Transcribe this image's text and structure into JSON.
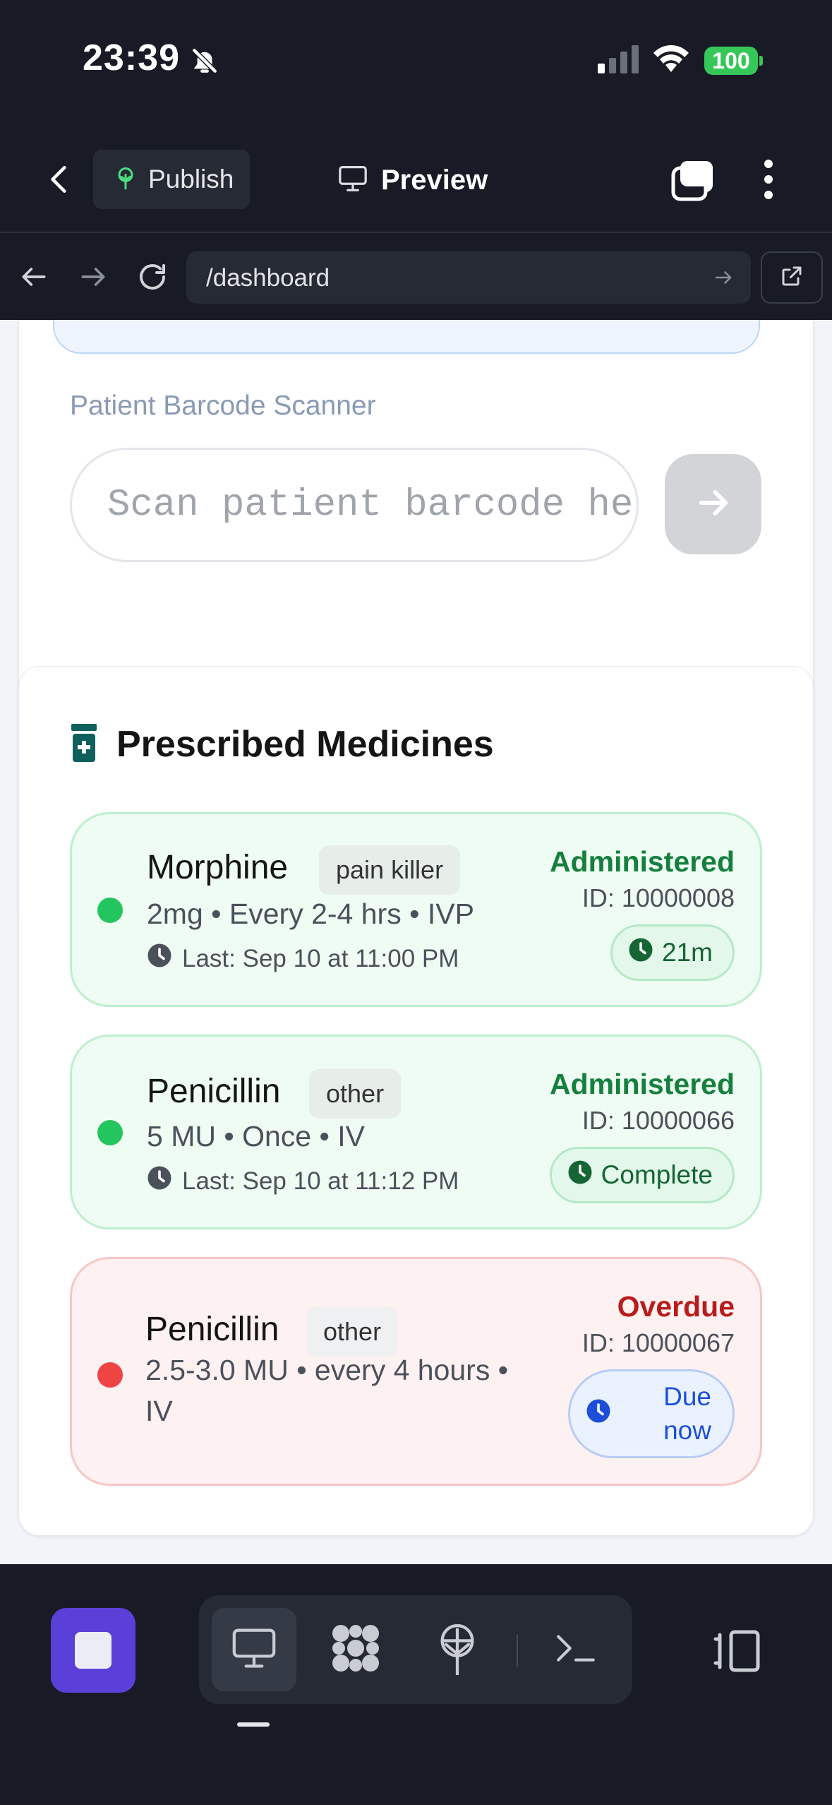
{
  "status_bar": {
    "time": "23:39",
    "battery": "100",
    "icons": [
      "bell-slash-icon",
      "cellular-signal-icon",
      "wifi-icon",
      "battery-icon"
    ]
  },
  "toolbar": {
    "publish_label": "Publish",
    "preview_label": "Preview",
    "icons": [
      "back-chevron-icon",
      "publish-tree-icon",
      "monitor-icon",
      "tabs-icon",
      "more-vertical-icon"
    ]
  },
  "url_bar": {
    "url": "/dashboard",
    "icons": [
      "arrow-left-icon",
      "arrow-right-icon",
      "reload-icon",
      "go-arrow-icon",
      "open-external-icon"
    ]
  },
  "scanner": {
    "label": "Patient Barcode Scanner",
    "placeholder": "Scan patient barcode here..."
  },
  "medicines": {
    "title": "Prescribed Medicines",
    "items": [
      {
        "name": "Morphine",
        "tag": "pain killer",
        "dose": "2mg • Every 2-4 hrs • IVP",
        "last": "Last: Sep 10 at 11:00 PM",
        "status": "Administered",
        "id": "ID: 10000008",
        "pill": "21m",
        "state": "ok"
      },
      {
        "name": "Penicillin",
        "tag": "other",
        "dose": "5 MU • Once • IV",
        "last": "Last: Sep 10 at 11:12 PM",
        "status": "Administered",
        "id": "ID: 10000066",
        "pill": "Complete",
        "state": "ok"
      },
      {
        "name": "Penicillin",
        "tag": "other",
        "dose_line1": "2.5-3.0 MU • every 4 hours •",
        "dose_line2": "IV",
        "status": "Overdue",
        "id": "ID: 10000067",
        "pill_line1": "Due",
        "pill_line2": "now",
        "state": "overdue"
      }
    ]
  },
  "bottom_bar": {
    "icons": [
      "stop-icon",
      "monitor-icon",
      "apps-grid-icon",
      "publish-tree-icon",
      "terminal-icon",
      "device-toggle-icon"
    ]
  },
  "colors": {
    "dark_bg": "#181b25",
    "accent_purple": "#5b3fd9",
    "ok_green": "#15803d",
    "overdue_red": "#b91c1c",
    "due_blue": "#1d4ed8"
  }
}
